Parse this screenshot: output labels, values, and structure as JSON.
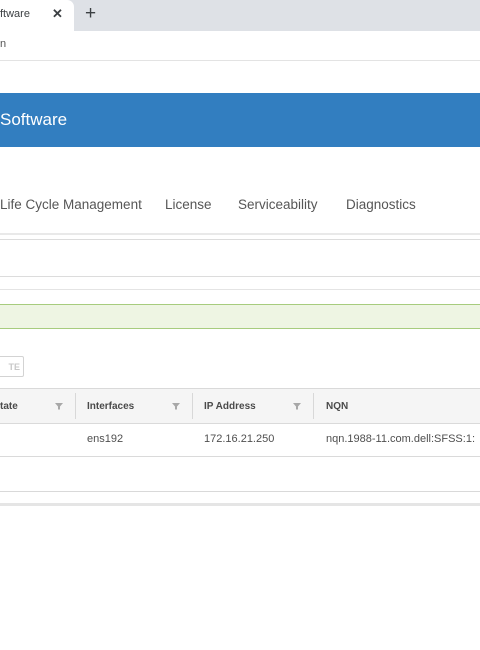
{
  "browser": {
    "tab_title": "ftware",
    "tab_close": "✕",
    "new_tab": "+",
    "address_fragment": "n"
  },
  "app": {
    "title": "Software"
  },
  "nav": {
    "tabs": [
      "Life Cycle Management",
      "License",
      "Serviceability",
      "Diagnostics"
    ]
  },
  "actions": {
    "state_button": "TE"
  },
  "grid": {
    "columns": [
      "State",
      "Interfaces",
      "IP Address",
      "NQN"
    ],
    "column_headers_visible": [
      "tate",
      "Interfaces",
      "IP Address",
      "NQN"
    ],
    "rows": [
      {
        "state": "",
        "interface": "ens192",
        "ip_address": "172.16.21.250",
        "nqn": "nqn.1988-11.com.dell:SFSS:1:"
      }
    ]
  },
  "colors": {
    "header_blue": "#327ec0",
    "success_bg": "#eef5e3",
    "success_border": "#a7cc7e"
  }
}
